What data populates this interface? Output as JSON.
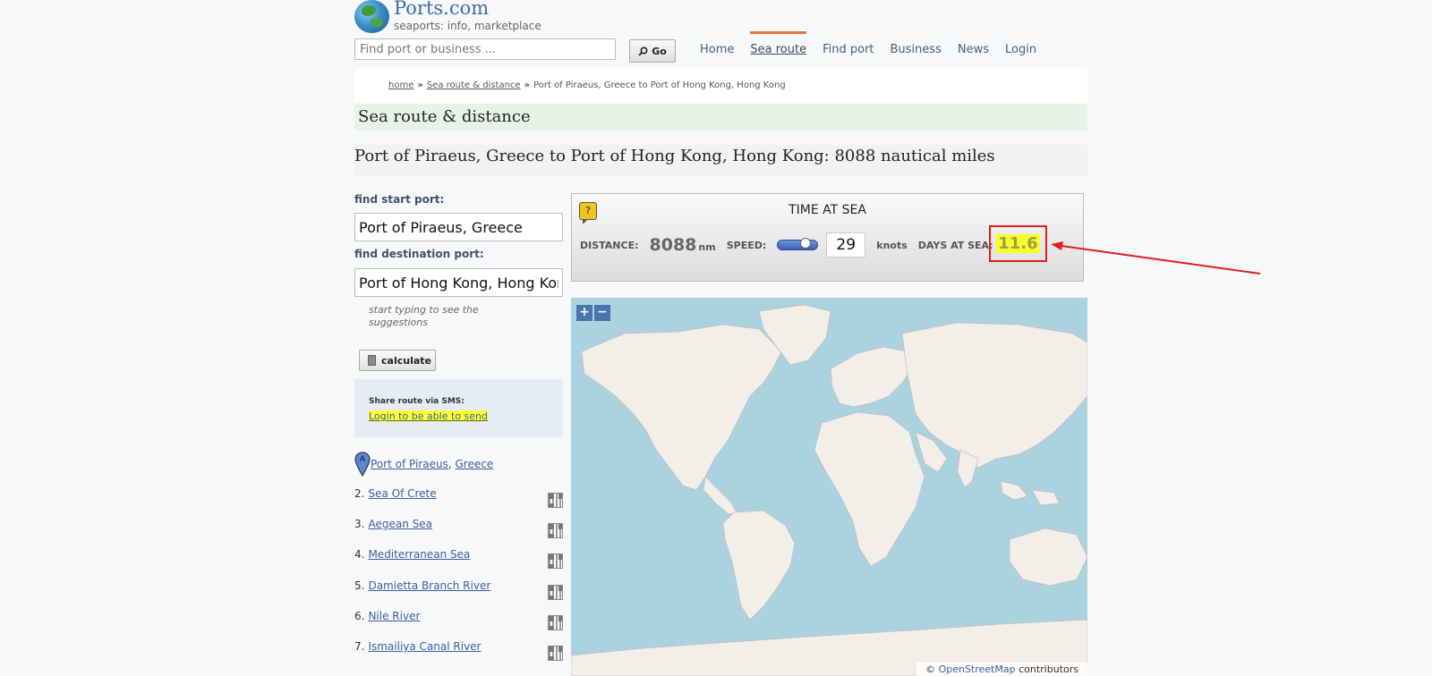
{
  "header": {
    "logo_text": "Ports.com",
    "logo_sub": "seaports: info, marketplace",
    "search_placeholder": "Find port or business ...",
    "go_label": "Go",
    "nav": [
      "Home",
      "Sea route",
      "Find port",
      "Business",
      "News",
      "Login"
    ],
    "nav_active": "Sea route"
  },
  "breadcrumb": {
    "home": "home",
    "sea_route": "Sea route & distance",
    "current": "Port of Piraeus, Greece to Port of Hong Kong, Hong Kong"
  },
  "section_title": "Sea route & distance",
  "route_title": "Port of Piraeus, Greece to Port of Hong Kong, Hong Kong: 8088 nautical miles",
  "form": {
    "start_label": "find start port:",
    "start_value": "Port of Piraeus, Greece",
    "dest_label": "find destination port:",
    "dest_value": "Port of Hong Kong, Hong Kong",
    "hint": "start typing to see the suggestions",
    "calculate_label": "calculate"
  },
  "sms": {
    "label": "Share route via SMS:",
    "link": "Login to be able to send"
  },
  "start_port": {
    "marker": "A",
    "port": "Port of Piraeus",
    "country": "Greece"
  },
  "route_items": [
    {
      "num": "2.",
      "name": "Sea Of Crete"
    },
    {
      "num": "3.",
      "name": "Aegean Sea"
    },
    {
      "num": "4.",
      "name": "Mediterranean Sea"
    },
    {
      "num": "5.",
      "name": "Damietta Branch River"
    },
    {
      "num": "6.",
      "name": "Nile River"
    },
    {
      "num": "7.",
      "name": "Ismailiya Canal River"
    }
  ],
  "time_at_sea": {
    "help": "?",
    "title": "TIME AT SEA",
    "distance_label": "DISTANCE:",
    "distance_value": "8088",
    "distance_unit": "nm",
    "speed_label": "SPEED:",
    "speed_value": "29",
    "speed_unit": "knots",
    "days_label": "DAYS AT SEA:",
    "days_value": "11.6"
  },
  "map": {
    "zoom_in": "+",
    "zoom_out": "−",
    "attrib_symbol": "©",
    "attrib_link": "OpenStreetMap",
    "attrib_rest": "contributors"
  },
  "colors": {
    "accent_nav": "#e8743b",
    "highlight": "#f6ff2a",
    "annotation": "#e21d1d",
    "ocean": "#aad3df",
    "land": "#f2efe9"
  }
}
